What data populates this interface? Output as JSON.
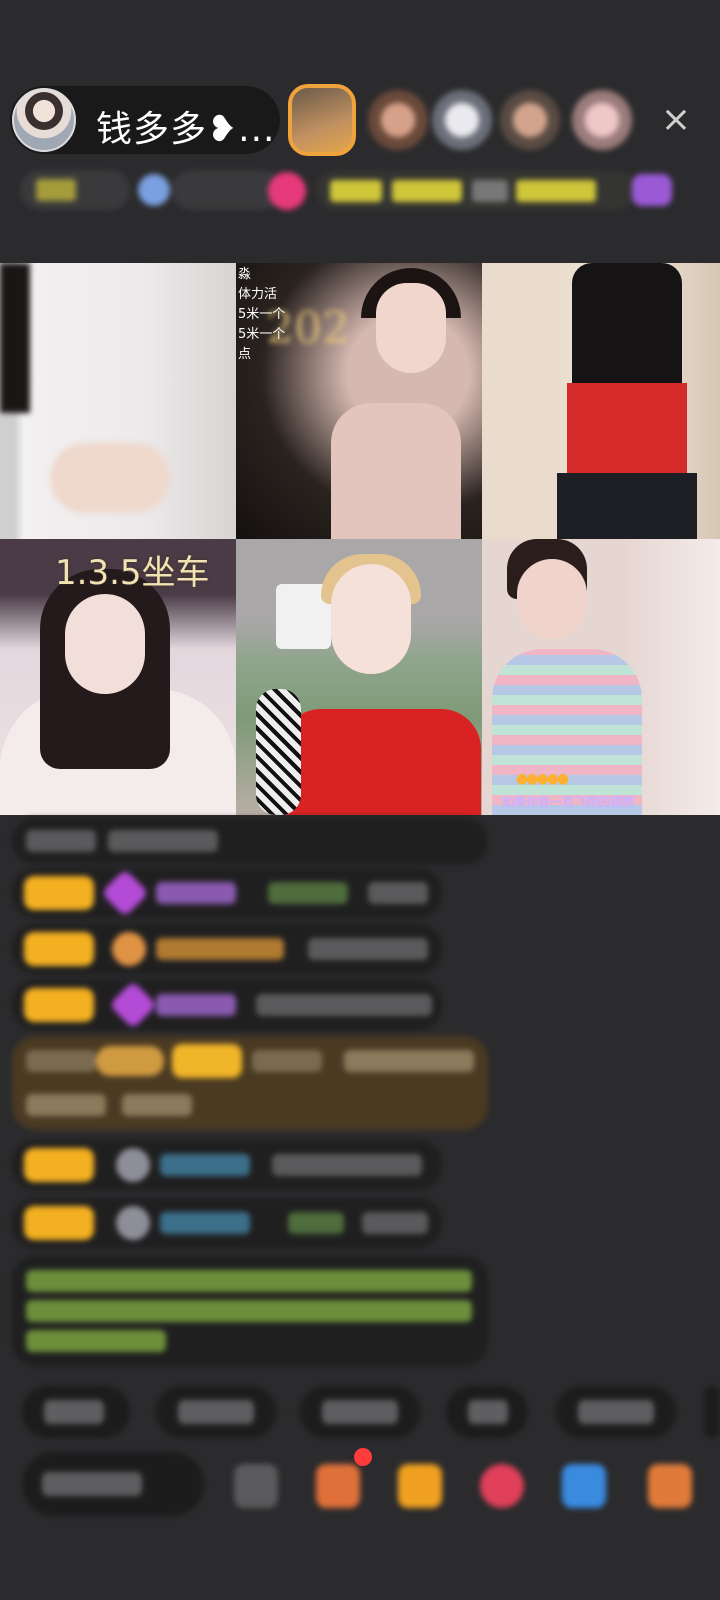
{
  "header": {
    "host_name": "钱多多❥...",
    "close_label": "×"
  },
  "grid": {
    "tile_labels": {
      "t2_side": "淼\n体力活\n5米一个\n5米一个\n点",
      "t2_lights": "202",
      "t4": "1.3.5坐车",
      "t6_tag": "如果你有一双飞翔的翅膀",
      "t6_badges": "●●●●●"
    }
  },
  "colors": {
    "background": "#2b2b2d",
    "level_badge": "#f3b021",
    "accent_red": "#ff3b3b"
  }
}
